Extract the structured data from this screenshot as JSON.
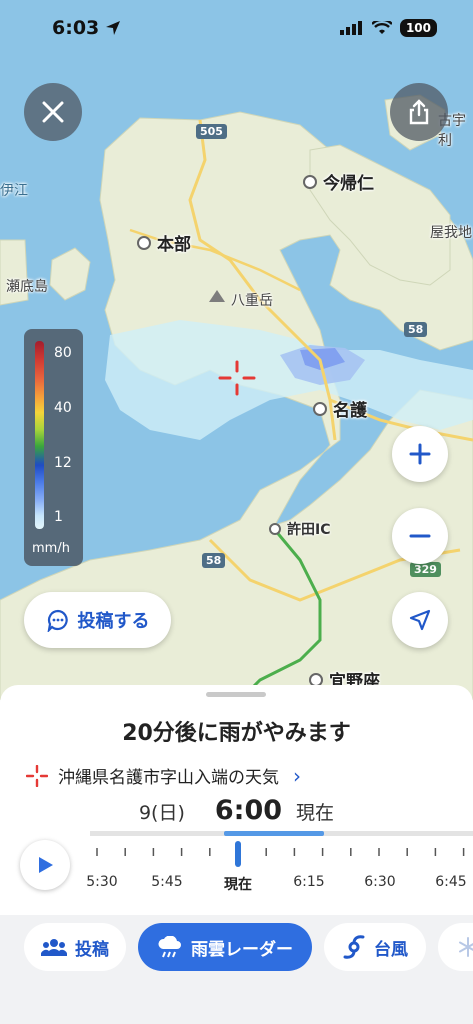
{
  "status_bar": {
    "time": "6:03",
    "battery": "100"
  },
  "map": {
    "places": {
      "motobu": "本部",
      "nakijin": "今帰仁",
      "yaedake": "八重岳",
      "nago": "名護",
      "kyoda_ic": "許田IC",
      "ginoza": "宜野座",
      "ie": "伊江",
      "sesoko": "瀬底島",
      "ogimi": "屋我地",
      "kouri": "古宇利"
    },
    "roads": {
      "r505": "505",
      "r58a": "58",
      "r58b": "58",
      "r329": "329"
    }
  },
  "legend": {
    "labels": [
      "80",
      "40",
      "12",
      "1"
    ],
    "unit": "mm/h"
  },
  "post_button": {
    "label": "投稿する"
  },
  "sheet": {
    "headline": "20分後に雨がやみます",
    "location": "沖縄県名護市字山入端の天気",
    "date": "9(日)",
    "current_time": "6:00",
    "now_label": "現在",
    "timeline": {
      "labels": [
        "5:30",
        "5:45",
        "現在",
        "6:15",
        "6:30",
        "6:45"
      ]
    }
  },
  "tabs": [
    {
      "label": "投稿"
    },
    {
      "label": "雨雲レーダー"
    },
    {
      "label": "台風"
    }
  ]
}
